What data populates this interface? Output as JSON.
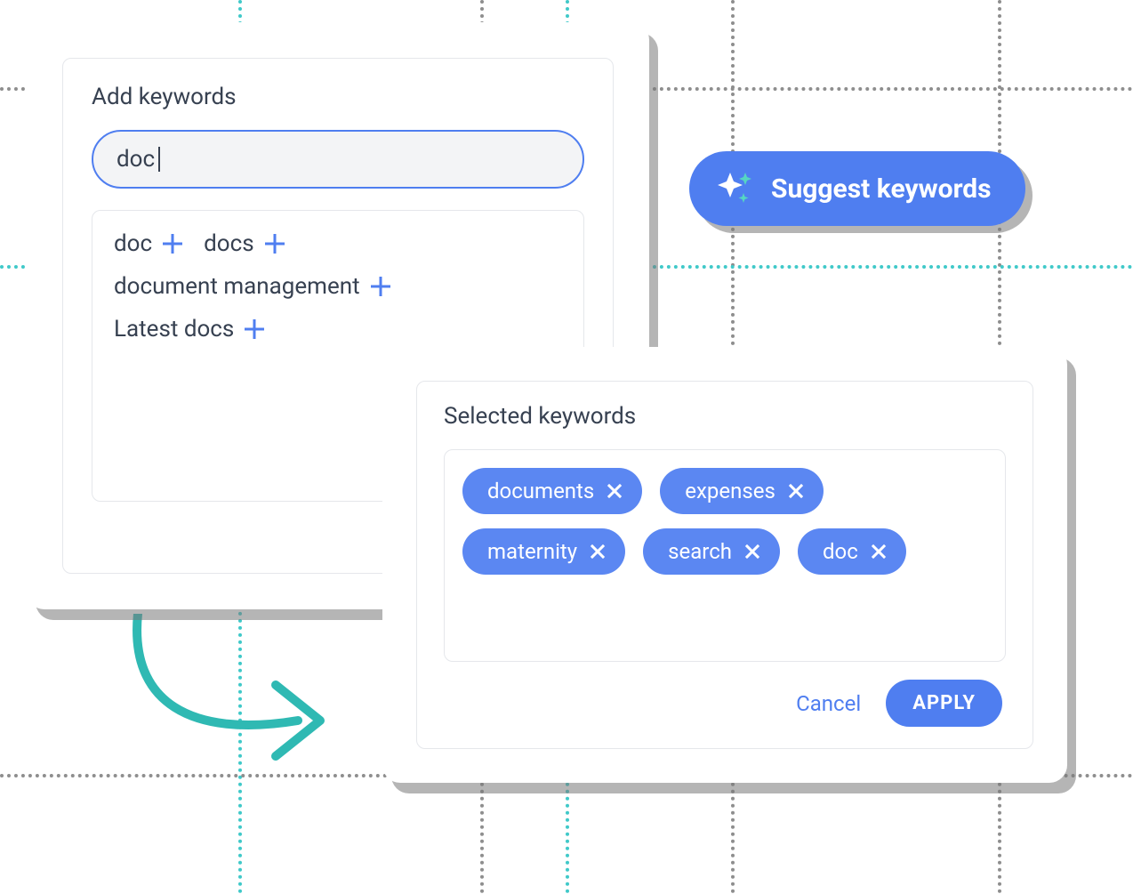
{
  "add_panel": {
    "title": "Add keywords",
    "input_value": "doc",
    "suggestions": [
      "doc",
      "docs",
      "document management",
      "Latest docs"
    ]
  },
  "suggest_button": {
    "label": "Suggest keywords"
  },
  "selected_panel": {
    "title": "Selected keywords",
    "chips": [
      "documents",
      "expenses",
      "maternity",
      "search",
      "doc"
    ],
    "cancel_label": "Cancel",
    "apply_label": "APPLY"
  },
  "colors": {
    "accent": "#4f7ef0",
    "teal": "#40c9c9"
  }
}
